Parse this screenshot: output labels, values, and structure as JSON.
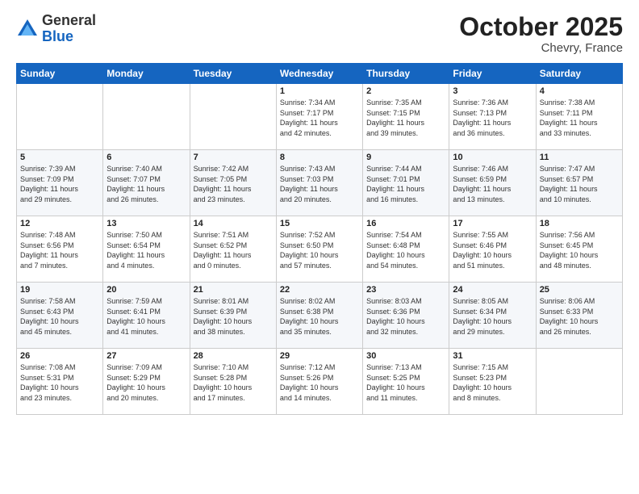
{
  "header": {
    "logo_general": "General",
    "logo_blue": "Blue",
    "month": "October 2025",
    "location": "Chevry, France"
  },
  "weekdays": [
    "Sunday",
    "Monday",
    "Tuesday",
    "Wednesday",
    "Thursday",
    "Friday",
    "Saturday"
  ],
  "weeks": [
    [
      {
        "day": "",
        "info": ""
      },
      {
        "day": "",
        "info": ""
      },
      {
        "day": "",
        "info": ""
      },
      {
        "day": "1",
        "info": "Sunrise: 7:34 AM\nSunset: 7:17 PM\nDaylight: 11 hours\nand 42 minutes."
      },
      {
        "day": "2",
        "info": "Sunrise: 7:35 AM\nSunset: 7:15 PM\nDaylight: 11 hours\nand 39 minutes."
      },
      {
        "day": "3",
        "info": "Sunrise: 7:36 AM\nSunset: 7:13 PM\nDaylight: 11 hours\nand 36 minutes."
      },
      {
        "day": "4",
        "info": "Sunrise: 7:38 AM\nSunset: 7:11 PM\nDaylight: 11 hours\nand 33 minutes."
      }
    ],
    [
      {
        "day": "5",
        "info": "Sunrise: 7:39 AM\nSunset: 7:09 PM\nDaylight: 11 hours\nand 29 minutes."
      },
      {
        "day": "6",
        "info": "Sunrise: 7:40 AM\nSunset: 7:07 PM\nDaylight: 11 hours\nand 26 minutes."
      },
      {
        "day": "7",
        "info": "Sunrise: 7:42 AM\nSunset: 7:05 PM\nDaylight: 11 hours\nand 23 minutes."
      },
      {
        "day": "8",
        "info": "Sunrise: 7:43 AM\nSunset: 7:03 PM\nDaylight: 11 hours\nand 20 minutes."
      },
      {
        "day": "9",
        "info": "Sunrise: 7:44 AM\nSunset: 7:01 PM\nDaylight: 11 hours\nand 16 minutes."
      },
      {
        "day": "10",
        "info": "Sunrise: 7:46 AM\nSunset: 6:59 PM\nDaylight: 11 hours\nand 13 minutes."
      },
      {
        "day": "11",
        "info": "Sunrise: 7:47 AM\nSunset: 6:57 PM\nDaylight: 11 hours\nand 10 minutes."
      }
    ],
    [
      {
        "day": "12",
        "info": "Sunrise: 7:48 AM\nSunset: 6:56 PM\nDaylight: 11 hours\nand 7 minutes."
      },
      {
        "day": "13",
        "info": "Sunrise: 7:50 AM\nSunset: 6:54 PM\nDaylight: 11 hours\nand 4 minutes."
      },
      {
        "day": "14",
        "info": "Sunrise: 7:51 AM\nSunset: 6:52 PM\nDaylight: 11 hours\nand 0 minutes."
      },
      {
        "day": "15",
        "info": "Sunrise: 7:52 AM\nSunset: 6:50 PM\nDaylight: 10 hours\nand 57 minutes."
      },
      {
        "day": "16",
        "info": "Sunrise: 7:54 AM\nSunset: 6:48 PM\nDaylight: 10 hours\nand 54 minutes."
      },
      {
        "day": "17",
        "info": "Sunrise: 7:55 AM\nSunset: 6:46 PM\nDaylight: 10 hours\nand 51 minutes."
      },
      {
        "day": "18",
        "info": "Sunrise: 7:56 AM\nSunset: 6:45 PM\nDaylight: 10 hours\nand 48 minutes."
      }
    ],
    [
      {
        "day": "19",
        "info": "Sunrise: 7:58 AM\nSunset: 6:43 PM\nDaylight: 10 hours\nand 45 minutes."
      },
      {
        "day": "20",
        "info": "Sunrise: 7:59 AM\nSunset: 6:41 PM\nDaylight: 10 hours\nand 41 minutes."
      },
      {
        "day": "21",
        "info": "Sunrise: 8:01 AM\nSunset: 6:39 PM\nDaylight: 10 hours\nand 38 minutes."
      },
      {
        "day": "22",
        "info": "Sunrise: 8:02 AM\nSunset: 6:38 PM\nDaylight: 10 hours\nand 35 minutes."
      },
      {
        "day": "23",
        "info": "Sunrise: 8:03 AM\nSunset: 6:36 PM\nDaylight: 10 hours\nand 32 minutes."
      },
      {
        "day": "24",
        "info": "Sunrise: 8:05 AM\nSunset: 6:34 PM\nDaylight: 10 hours\nand 29 minutes."
      },
      {
        "day": "25",
        "info": "Sunrise: 8:06 AM\nSunset: 6:33 PM\nDaylight: 10 hours\nand 26 minutes."
      }
    ],
    [
      {
        "day": "26",
        "info": "Sunrise: 7:08 AM\nSunset: 5:31 PM\nDaylight: 10 hours\nand 23 minutes."
      },
      {
        "day": "27",
        "info": "Sunrise: 7:09 AM\nSunset: 5:29 PM\nDaylight: 10 hours\nand 20 minutes."
      },
      {
        "day": "28",
        "info": "Sunrise: 7:10 AM\nSunset: 5:28 PM\nDaylight: 10 hours\nand 17 minutes."
      },
      {
        "day": "29",
        "info": "Sunrise: 7:12 AM\nSunset: 5:26 PM\nDaylight: 10 hours\nand 14 minutes."
      },
      {
        "day": "30",
        "info": "Sunrise: 7:13 AM\nSunset: 5:25 PM\nDaylight: 10 hours\nand 11 minutes."
      },
      {
        "day": "31",
        "info": "Sunrise: 7:15 AM\nSunset: 5:23 PM\nDaylight: 10 hours\nand 8 minutes."
      },
      {
        "day": "",
        "info": ""
      }
    ]
  ]
}
